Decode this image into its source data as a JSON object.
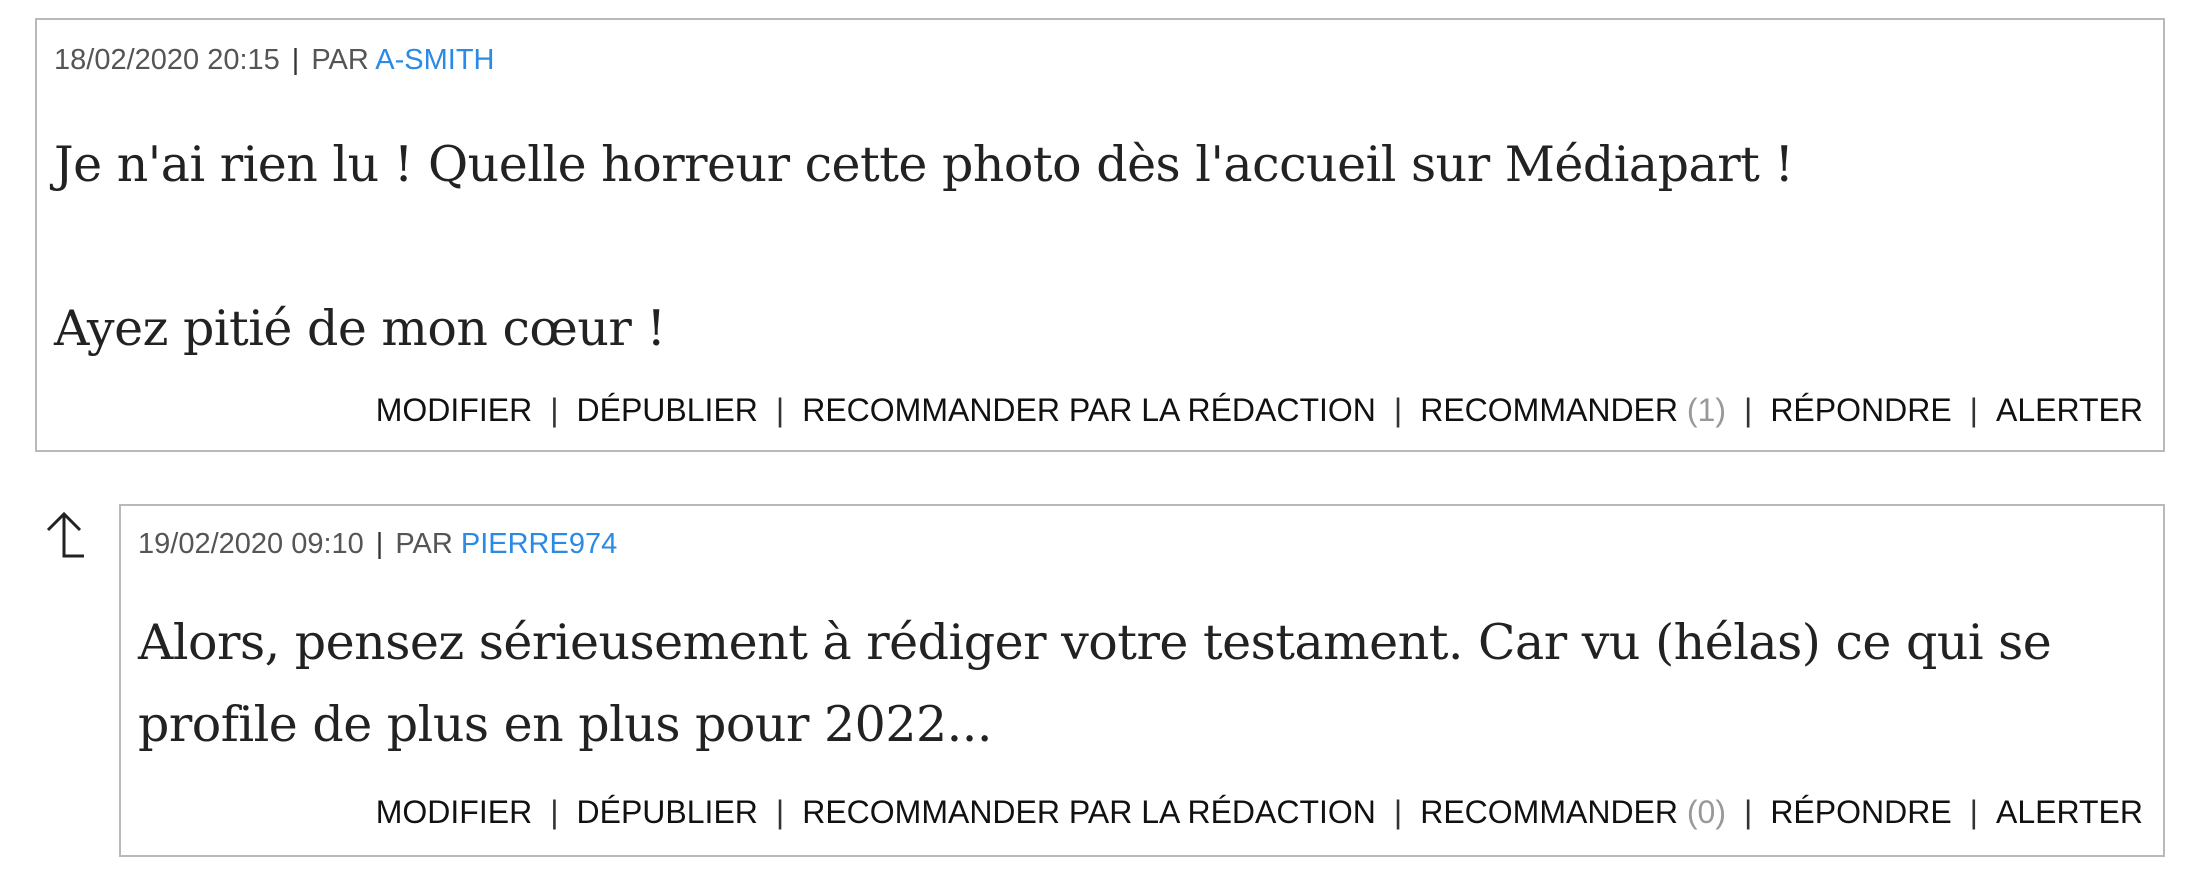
{
  "comments": [
    {
      "date": "18/02/2020 20:15",
      "by_label": "PAR",
      "author": "A-SMITH",
      "paragraphs": [
        "Je n'ai rien lu ! Quelle horreur cette photo dès l'accueil sur Médiapart !",
        "Ayez pitié de mon cœur !"
      ],
      "actions": {
        "modify": "MODIFIER",
        "unpublish": "DÉPUBLIER",
        "recommend_editorial": "RECOMMANDER PAR LA RÉDACTION",
        "recommend": "RECOMMANDER",
        "recommend_count": "(1)",
        "reply": "RÉPONDRE",
        "alert": "ALERTER"
      }
    },
    {
      "date": "19/02/2020 09:10",
      "by_label": "PAR",
      "author": "PIERRE974",
      "paragraphs": [
        "Alors, pensez sérieusement à rédiger votre testament. Car vu (hélas) ce qui se profile de plus en plus pour 2022..."
      ],
      "actions": {
        "modify": "MODIFIER",
        "unpublish": "DÉPUBLIER",
        "recommend_editorial": "RECOMMANDER PAR LA RÉDACTION",
        "recommend": "RECOMMANDER",
        "recommend_count": "(0)",
        "reply": "RÉPONDRE",
        "alert": "ALERTER"
      }
    }
  ],
  "separator": "|",
  "colors": {
    "author_link": "#2b8ae6",
    "border": "#b9b9b9",
    "count": "#999999"
  },
  "icons": {
    "reply_indicator": "reply-arrow-up-icon"
  }
}
